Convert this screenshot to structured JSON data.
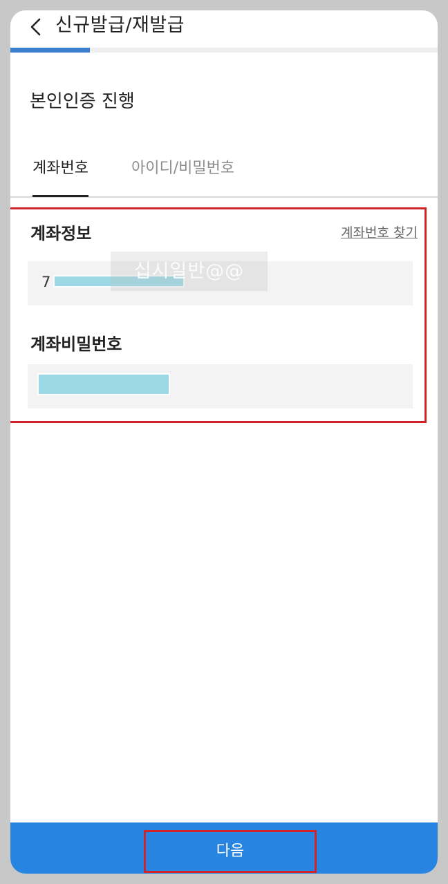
{
  "header": {
    "title": "신규발급/재발급",
    "back_icon": "chevron-left-icon"
  },
  "progress": {
    "fraction": 0.2,
    "color": "#3a7fd0"
  },
  "page": {
    "heading": "본인인증 진행"
  },
  "tabs": [
    {
      "label": "계좌번호",
      "active": true
    },
    {
      "label": "아이디/비밀번호",
      "active": false
    }
  ],
  "form": {
    "account_info_label": "계좌정보",
    "find_account_link": "계좌번호 찾기",
    "account_number_prefix": "7",
    "account_password_label": "계좌비밀번호"
  },
  "watermark": "십시일반@@",
  "footer": {
    "next_label": "다음",
    "color": "#2784e0"
  },
  "colors": {
    "highlight": "#d2232a",
    "mask": "#9cd8e6",
    "accent": "#2784e0"
  }
}
